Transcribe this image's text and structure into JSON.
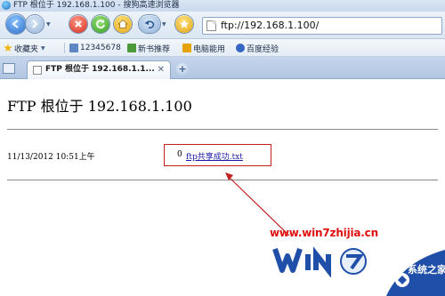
{
  "window": {
    "title": "FTP 根位于 192.168.1.100 - 搜狗高速浏览器"
  },
  "navbar": {
    "address_url": "ftp://192.168.1.100/",
    "back_icon": "back-arrow-icon",
    "forward_icon": "forward-arrow-icon",
    "stop_icon": "stop-icon",
    "refresh_icon": "refresh-icon",
    "home_icon": "home-icon",
    "undo_icon": "undo-close-icon",
    "favorite_icon": "star-icon"
  },
  "bookmarks": {
    "favorites_label": "收藏夹",
    "items": [
      {
        "label": "12345678",
        "icon": "hash-icon"
      },
      {
        "label": "新书推荐",
        "icon": "book-icon"
      },
      {
        "label": "电脑能用",
        "icon": "lightning-icon"
      },
      {
        "label": "百度经验",
        "icon": "paw-icon"
      }
    ]
  },
  "tabs": [
    {
      "label": "FTP 根位于 192.168.1.1...",
      "active": true
    }
  ],
  "page": {
    "heading": "FTP 根位于 192.168.1.100",
    "files": [
      {
        "date": "11/13/2012 10:51上午",
        "size": "0",
        "name": "ftp共享成功.txt"
      }
    ]
  },
  "watermark": {
    "url": "www.win7zhijia.cn",
    "corner": "系统之家",
    "colors": {
      "url": "#e01010",
      "logo": "#1f4fa8"
    }
  },
  "colors": {
    "highlight_box": "#c02020",
    "link": "#1a1aa8"
  }
}
